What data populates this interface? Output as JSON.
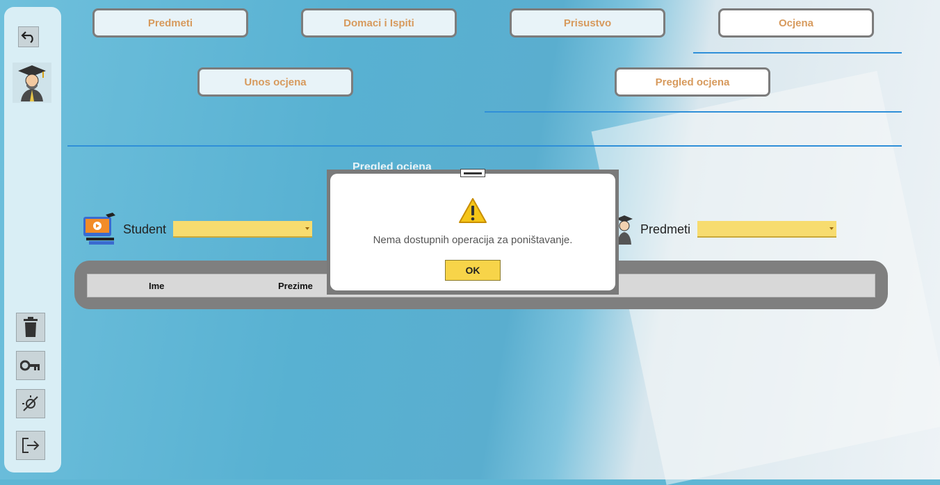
{
  "sidebar": {
    "undo_icon": "undo-icon",
    "avatar_icon": "graduate-avatar-icon",
    "bottom_buttons": [
      {
        "icon": "trash-icon"
      },
      {
        "icon": "key-icon"
      },
      {
        "icon": "theme-toggle-icon"
      },
      {
        "icon": "logout-icon"
      }
    ]
  },
  "tabs": {
    "predmeti": "Predmeti",
    "domaci": "Domaci i Ispiti",
    "prisustvo": "Prisustvo",
    "ocjena": "Ocjena"
  },
  "subtabs": {
    "unos": "Unos ocjena",
    "pregled": "Pregled ocjena"
  },
  "section_title": "Pregled ocjena",
  "filters": {
    "student_label": "Student",
    "student_value": "",
    "predmeti_label": "Predmeti",
    "predmeti_value": ""
  },
  "grid": {
    "columns": [
      "Ime",
      "Prezime"
    ]
  },
  "dialog": {
    "icon": "warning-icon",
    "message": "Nema dostupnih operacija za poništavanje.",
    "ok_label": "OK"
  },
  "colors": {
    "tab_text": "#d79a5d",
    "accent_line": "#2f8fd8",
    "combo_bg": "#f7dc6f",
    "ok_bg": "#f7d449"
  }
}
